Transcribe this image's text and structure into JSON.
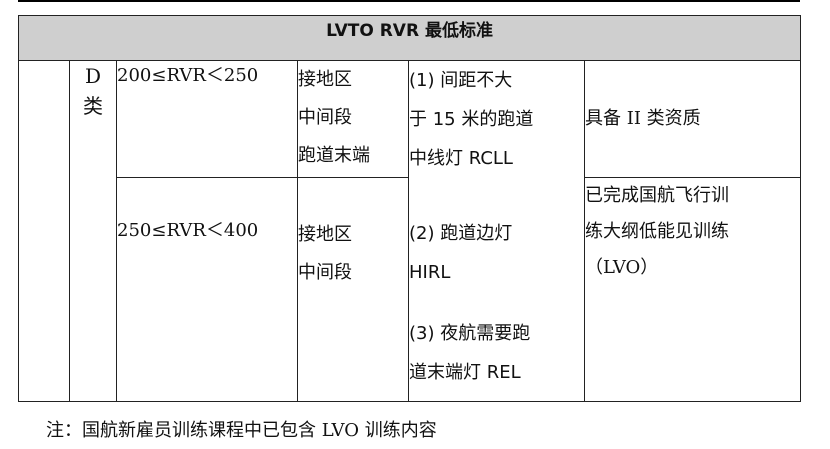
{
  "table": {
    "title": "LVTO RVR 最低标准",
    "class_label_line1": "D",
    "class_label_line2": "类",
    "rows": [
      {
        "rvr": "200≤RVR＜250",
        "zone_lines": [
          "接地区",
          "中间段",
          "跑道末端"
        ],
        "qualification_lines": [
          "具备 II 类资质"
        ]
      },
      {
        "rvr": "250≤RVR＜400",
        "zone_lines": [
          "接地区",
          "中间段"
        ],
        "qualification_lines": [
          "已完成国航飞行训",
          "练大纲低能见训练",
          "（LVO）"
        ]
      }
    ],
    "lights_lines": [
      "(1)  间距不大",
      "于 15 米的跑道",
      "中线灯 RCLL",
      "(2)  跑道边灯",
      "HIRL",
      "(3) 夜航需要跑",
      "道末端灯  REL"
    ]
  },
  "note": "注：国航新雇员训练课程中已包含 LVO 训练内容"
}
